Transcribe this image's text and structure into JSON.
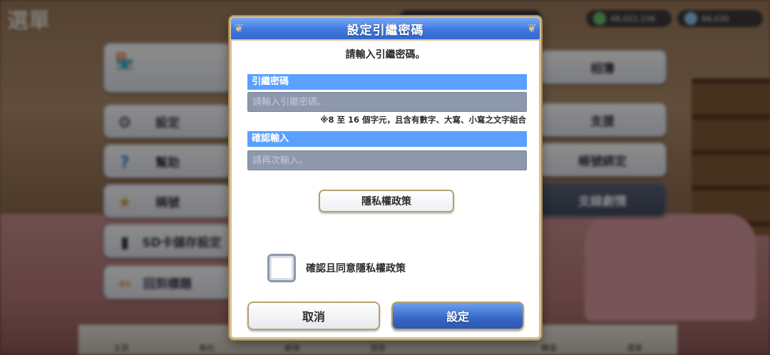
{
  "background": {
    "title": "選單",
    "currency_1": "48,022,156",
    "currency_2": "66,030",
    "left_menu": [
      {
        "label": "",
        "icon": "shop-icon"
      },
      {
        "label": "設定",
        "icon": "gear-icon"
      },
      {
        "label": "幫助",
        "icon": "help-icon"
      },
      {
        "label": "稱號",
        "icon": "title-icon"
      },
      {
        "label": "SD卡儲存設定",
        "icon": "sd-card-icon"
      },
      {
        "label": "回到標題",
        "icon": "return-icon"
      }
    ],
    "right_menu": [
      {
        "label": "相簿",
        "icon": "album-icon"
      },
      {
        "label": "支援",
        "icon": "support-icon"
      },
      {
        "label": "帳號綁定",
        "icon": "link-icon"
      },
      {
        "label": "支線劇情",
        "icon": "story-icon"
      }
    ],
    "nav_tabs": [
      "主頁",
      "角色",
      "劇情",
      "冒險",
      "",
      "轉蛋",
      "選單"
    ]
  },
  "dialog": {
    "title": "設定引繼密碼",
    "subtitle": "請輸入引繼密碼。",
    "password_label": "引繼密碼",
    "password_placeholder": "請輸入引繼密碼。",
    "password_hint": "※8 至 16 個字元，且含有數字、大寫、小寫之文字組合",
    "confirm_label": "確認輸入",
    "confirm_placeholder": "請再次輸入。",
    "privacy_button": "隱私權政策",
    "agree_label": "確認且同意隱私權政策",
    "cancel_button": "取消",
    "submit_button": "設定"
  }
}
